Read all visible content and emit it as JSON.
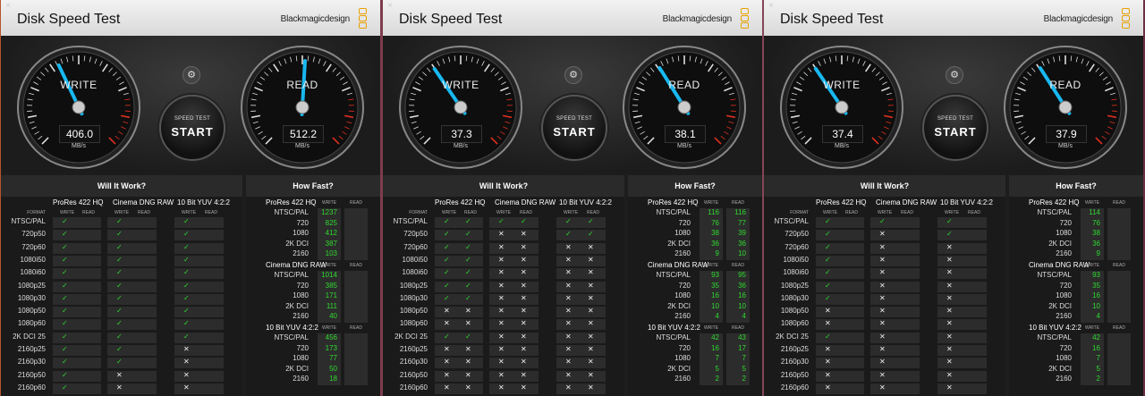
{
  "windows": [
    {
      "title": "Disk Speed Test",
      "brand": "Blackmagicdesign",
      "write_label": "WRITE",
      "read_label": "READ",
      "write_value": "406.0",
      "read_value": "512.2",
      "unit": "MB/s",
      "write_speed": 406.0,
      "read_speed": 512.2,
      "start_small": "SPEED TEST",
      "start_big": "START",
      "will_it_work": "Will It Work?",
      "how_fast": "How Fast?",
      "format_label": "FORMAT",
      "groups": [
        "ProRes 422 HQ",
        "Cinema DNG RAW",
        "10 Bit YUV 4:2:2"
      ],
      "sub_write": "WRITE",
      "sub_read": "READ",
      "formats": [
        "NTSC/PAL",
        "720p50",
        "720p60",
        "1080i50",
        "1080i60",
        "1080p25",
        "1080p30",
        "1080p50",
        "1080p60",
        "2K DCI 25",
        "2160p25",
        "2160p30",
        "2160p50",
        "2160p60"
      ],
      "matrix": [
        [
          "y",
          "",
          "y",
          "",
          "y",
          ""
        ],
        [
          "y",
          "",
          "y",
          "",
          "y",
          ""
        ],
        [
          "y",
          "",
          "y",
          "",
          "y",
          ""
        ],
        [
          "y",
          "",
          "y",
          "",
          "y",
          ""
        ],
        [
          "y",
          "",
          "y",
          "",
          "y",
          ""
        ],
        [
          "y",
          "",
          "y",
          "",
          "y",
          ""
        ],
        [
          "y",
          "",
          "y",
          "",
          "y",
          ""
        ],
        [
          "y",
          "",
          "y",
          "",
          "y",
          ""
        ],
        [
          "y",
          "",
          "y",
          "",
          "y",
          ""
        ],
        [
          "y",
          "",
          "y",
          "",
          "y",
          ""
        ],
        [
          "y",
          "",
          "y",
          "",
          "x",
          ""
        ],
        [
          "y",
          "",
          "y",
          "",
          "x",
          ""
        ],
        [
          "y",
          "",
          "x",
          "",
          "x",
          ""
        ],
        [
          "y",
          "",
          "x",
          "",
          "x",
          ""
        ]
      ],
      "howfast": [
        {
          "name": "ProRes 422 HQ",
          "rows": [
            [
              "NTSC/PAL",
              "1237"
            ],
            [
              "720",
              "825"
            ],
            [
              "1080",
              "412"
            ],
            [
              "2K DCI",
              "387"
            ],
            [
              "2160",
              "103"
            ]
          ]
        },
        {
          "name": "Cinema DNG RAW",
          "rows": [
            [
              "NTSC/PAL",
              "1014"
            ],
            [
              "720",
              "385"
            ],
            [
              "1080",
              "171"
            ],
            [
              "2K DCI",
              "111"
            ],
            [
              "2160",
              "40"
            ]
          ]
        },
        {
          "name": "10 Bit YUV 4:2:2",
          "rows": [
            [
              "NTSC/PAL",
              "456"
            ],
            [
              "720",
              "173"
            ],
            [
              "1080",
              "77"
            ],
            [
              "2K DCI",
              "50"
            ],
            [
              "2160",
              "18"
            ]
          ]
        }
      ]
    },
    {
      "title": "Disk Speed Test",
      "brand": "Blackmagicdesign",
      "write_label": "WRITE",
      "read_label": "READ",
      "write_value": "37.3",
      "read_value": "38.1",
      "unit": "MB/s",
      "write_speed": 37.3,
      "read_speed": 38.1,
      "start_small": "SPEED TEST",
      "start_big": "START",
      "will_it_work": "Will It Work?",
      "how_fast": "How Fast?",
      "format_label": "FORMAT",
      "groups": [
        "ProRes 422 HQ",
        "Cinema DNG RAW",
        "10 Bit YUV 4:2:2"
      ],
      "sub_write": "WRITE",
      "sub_read": "READ",
      "formats": [
        "NTSC/PAL",
        "720p50",
        "720p60",
        "1080i50",
        "1080i60",
        "1080p25",
        "1080p30",
        "1080p50",
        "1080p60",
        "2K DCI 25",
        "2160p25",
        "2160p30",
        "2160p50",
        "2160p60"
      ],
      "matrix": [
        [
          "y",
          "y",
          "y",
          "y",
          "y",
          "y"
        ],
        [
          "y",
          "y",
          "x",
          "x",
          "y",
          "y"
        ],
        [
          "y",
          "y",
          "x",
          "x",
          "x",
          "x"
        ],
        [
          "y",
          "y",
          "x",
          "x",
          "x",
          "x"
        ],
        [
          "y",
          "y",
          "x",
          "x",
          "x",
          "x"
        ],
        [
          "y",
          "y",
          "x",
          "x",
          "x",
          "x"
        ],
        [
          "y",
          "y",
          "x",
          "x",
          "x",
          "x"
        ],
        [
          "x",
          "x",
          "x",
          "x",
          "x",
          "x"
        ],
        [
          "x",
          "x",
          "x",
          "x",
          "x",
          "x"
        ],
        [
          "y",
          "y",
          "x",
          "x",
          "x",
          "x"
        ],
        [
          "x",
          "x",
          "x",
          "x",
          "x",
          "x"
        ],
        [
          "x",
          "x",
          "x",
          "x",
          "x",
          "x"
        ],
        [
          "x",
          "x",
          "x",
          "x",
          "x",
          "x"
        ],
        [
          "x",
          "x",
          "x",
          "x",
          "x",
          "x"
        ]
      ],
      "howfast": [
        {
          "name": "ProRes 422 HQ",
          "rows": [
            [
              "NTSC/PAL",
              "116",
              "116"
            ],
            [
              "720",
              "76",
              "77"
            ],
            [
              "1080",
              "38",
              "39"
            ],
            [
              "2K DCI",
              "36",
              "36"
            ],
            [
              "2160",
              "9",
              "10"
            ]
          ]
        },
        {
          "name": "Cinema DNG RAW",
          "rows": [
            [
              "NTSC/PAL",
              "93",
              "95"
            ],
            [
              "720",
              "35",
              "36"
            ],
            [
              "1080",
              "16",
              "16"
            ],
            [
              "2K DCI",
              "10",
              "10"
            ],
            [
              "2160",
              "4",
              "4"
            ]
          ]
        },
        {
          "name": "10 Bit YUV 4:2:2",
          "rows": [
            [
              "NTSC/PAL",
              "42",
              "43"
            ],
            [
              "720",
              "16",
              "17"
            ],
            [
              "1080",
              "7",
              "7"
            ],
            [
              "2K DCI",
              "5",
              "5"
            ],
            [
              "2160",
              "2",
              "2"
            ]
          ]
        }
      ]
    },
    {
      "title": "Disk Speed Test",
      "brand": "Blackmagicdesign",
      "write_label": "WRITE",
      "read_label": "READ",
      "write_value": "37.4",
      "read_value": "37.9",
      "unit": "MB/s",
      "write_speed": 37.4,
      "read_speed": 37.9,
      "start_small": "SPEED TEST",
      "start_big": "START",
      "will_it_work": "Will It Work?",
      "how_fast": "How Fast?",
      "format_label": "FORMAT",
      "groups": [
        "ProRes 422 HQ",
        "Cinema DNG RAW",
        "10 Bit YUV 4:2:2"
      ],
      "sub_write": "WRITE",
      "sub_read": "READ",
      "formats": [
        "NTSC/PAL",
        "720p50",
        "720p60",
        "1080i50",
        "1080i60",
        "1080p25",
        "1080p30",
        "1080p50",
        "1080p60",
        "2K DCI 25",
        "2160p25",
        "2160p30",
        "2160p50",
        "2160p60"
      ],
      "matrix": [
        [
          "y",
          "",
          "y",
          "",
          "y",
          ""
        ],
        [
          "y",
          "",
          "x",
          "",
          "y",
          ""
        ],
        [
          "y",
          "",
          "x",
          "",
          "x",
          ""
        ],
        [
          "y",
          "",
          "x",
          "",
          "x",
          ""
        ],
        [
          "y",
          "",
          "x",
          "",
          "x",
          ""
        ],
        [
          "y",
          "",
          "x",
          "",
          "x",
          ""
        ],
        [
          "y",
          "",
          "x",
          "",
          "x",
          ""
        ],
        [
          "x",
          "",
          "x",
          "",
          "x",
          ""
        ],
        [
          "x",
          "",
          "x",
          "",
          "x",
          ""
        ],
        [
          "y",
          "",
          "x",
          "",
          "x",
          ""
        ],
        [
          "x",
          "",
          "x",
          "",
          "x",
          ""
        ],
        [
          "x",
          "",
          "x",
          "",
          "x",
          ""
        ],
        [
          "x",
          "",
          "x",
          "",
          "x",
          ""
        ],
        [
          "x",
          "",
          "x",
          "",
          "x",
          ""
        ]
      ],
      "howfast": [
        {
          "name": "ProRes 422 HQ",
          "rows": [
            [
              "NTSC/PAL",
              "114"
            ],
            [
              "720",
              "76"
            ],
            [
              "1080",
              "38"
            ],
            [
              "2K DCI",
              "36"
            ],
            [
              "2160",
              "9"
            ]
          ]
        },
        {
          "name": "Cinema DNG RAW",
          "rows": [
            [
              "NTSC/PAL",
              "93"
            ],
            [
              "720",
              "35"
            ],
            [
              "1080",
              "16"
            ],
            [
              "2K DCI",
              "10"
            ],
            [
              "2160",
              "4"
            ]
          ]
        },
        {
          "name": "10 Bit YUV 4:2:2",
          "rows": [
            [
              "NTSC/PAL",
              "42"
            ],
            [
              "720",
              "16"
            ],
            [
              "1080",
              "7"
            ],
            [
              "2K DCI",
              "5"
            ],
            [
              "2160",
              "2"
            ]
          ]
        }
      ]
    }
  ],
  "colors": {
    "check": "#2fd92f",
    "needle": "#19b8f0",
    "redzone": "#e03020",
    "logo": "#e8a000"
  },
  "icons": {
    "close": "close-icon",
    "settings": "gear-icon",
    "logo": "blackmagic-logo-icon",
    "check": "check-icon",
    "cross": "cross-icon"
  }
}
